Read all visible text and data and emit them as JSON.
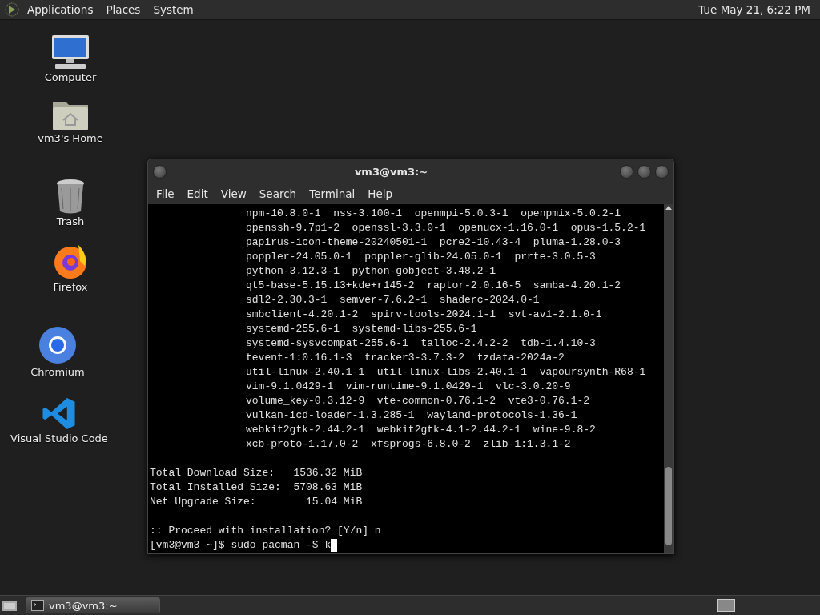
{
  "top_panel": {
    "menus": [
      "Applications",
      "Places",
      "System"
    ],
    "clock": "Tue May 21,  6:22 PM"
  },
  "desktop_icons": [
    {
      "kind": "computer",
      "label": "Computer"
    },
    {
      "kind": "home",
      "label": "vm3's Home"
    },
    {
      "kind": "trash",
      "label": "Trash"
    },
    {
      "kind": "firefox",
      "label": "Firefox"
    },
    {
      "kind": "chromium",
      "label": "Chromium"
    },
    {
      "kind": "vscode",
      "label": "Visual Studio Code"
    }
  ],
  "terminal": {
    "title": "vm3@vm3:~",
    "menu": [
      "File",
      "Edit",
      "View",
      "Search",
      "Terminal",
      "Help"
    ],
    "lines": [
      {
        "kind": "package",
        "text": "npm-10.8.0-1  nss-3.100-1  openmpi-5.0.3-1  openpmix-5.0.2-1"
      },
      {
        "kind": "package",
        "text": "openssh-9.7p1-2  openssl-3.3.0-1  openucx-1.16.0-1  opus-1.5.2-1"
      },
      {
        "kind": "package",
        "text": "papirus-icon-theme-20240501-1  pcre2-10.43-4  pluma-1.28.0-3"
      },
      {
        "kind": "package",
        "text": "poppler-24.05.0-1  poppler-glib-24.05.0-1  prrte-3.0.5-3"
      },
      {
        "kind": "package",
        "text": "python-3.12.3-1  python-gobject-3.48.2-1"
      },
      {
        "kind": "package",
        "text": "qt5-base-5.15.13+kde+r145-2  raptor-2.0.16-5  samba-4.20.1-2"
      },
      {
        "kind": "package",
        "text": "sdl2-2.30.3-1  semver-7.6.2-1  shaderc-2024.0-1"
      },
      {
        "kind": "package",
        "text": "smbclient-4.20.1-2  spirv-tools-2024.1-1  svt-av1-2.1.0-1"
      },
      {
        "kind": "package",
        "text": "systemd-255.6-1  systemd-libs-255.6-1"
      },
      {
        "kind": "package",
        "text": "systemd-sysvcompat-255.6-1  talloc-2.4.2-2  tdb-1.4.10-3"
      },
      {
        "kind": "package",
        "text": "tevent-1:0.16.1-3  tracker3-3.7.3-2  tzdata-2024a-2"
      },
      {
        "kind": "package",
        "text": "util-linux-2.40.1-1  util-linux-libs-2.40.1-1  vapoursynth-R68-1"
      },
      {
        "kind": "package",
        "text": "vim-9.1.0429-1  vim-runtime-9.1.0429-1  vlc-3.0.20-9"
      },
      {
        "kind": "package",
        "text": "volume_key-0.3.12-9  vte-common-0.76.1-2  vte3-0.76.1-2"
      },
      {
        "kind": "package",
        "text": "vulkan-icd-loader-1.3.285-1  wayland-protocols-1.36-1"
      },
      {
        "kind": "package",
        "text": "webkit2gtk-2.44.2-1  webkit2gtk-4.1-2.44.2-1  wine-9.8-2"
      },
      {
        "kind": "package",
        "text": "xcb-proto-1.17.0-2  xfsprogs-6.8.0-2  zlib-1:1.3.1-2"
      },
      {
        "kind": "blank"
      },
      {
        "kind": "output",
        "text": "Total Download Size:   1536.32 MiB"
      },
      {
        "kind": "output",
        "text": "Total Installed Size:  5708.63 MiB"
      },
      {
        "kind": "output",
        "text": "Net Upgrade Size:        15.04 MiB"
      },
      {
        "kind": "blank"
      },
      {
        "kind": "output",
        "text": ":: Proceed with installation? [Y/n] n"
      },
      {
        "kind": "prompt",
        "text": "[vm3@vm3 ~]$ sudo pacman -S k"
      }
    ]
  },
  "taskbar": {
    "tasks": [
      {
        "label": "vm3@vm3:~",
        "selected": true
      }
    ]
  }
}
